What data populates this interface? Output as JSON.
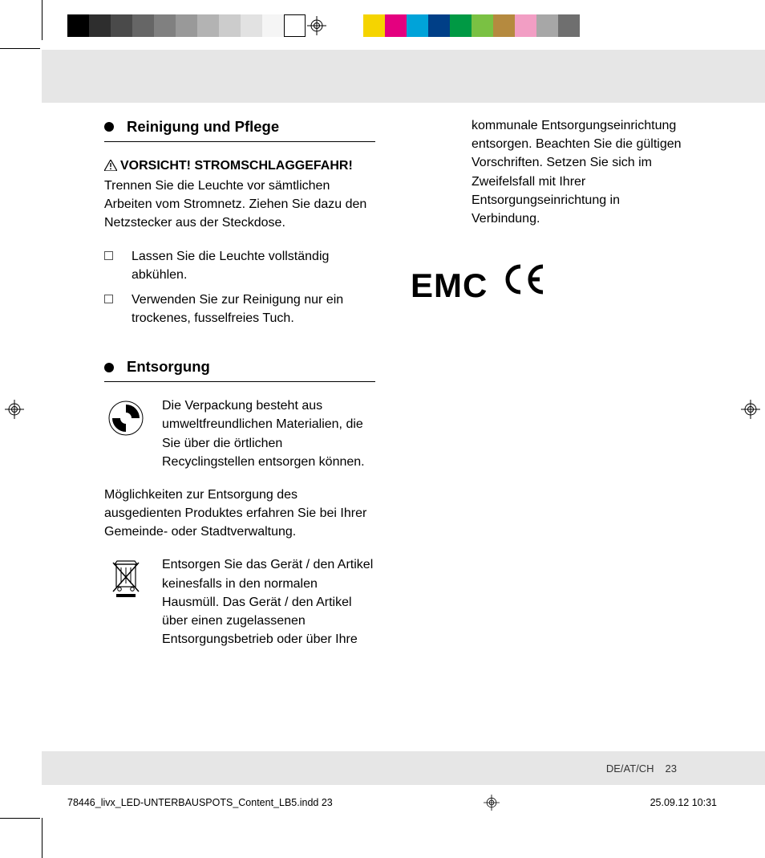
{
  "colorbar": {
    "left_group": [
      "#000000",
      "#2e2e2e",
      "#4a4a4a",
      "#666666",
      "#808080",
      "#999999",
      "#b3b3b3",
      "#cccccc",
      "#e2e2e2",
      "#f5f5f5",
      "#ffffff"
    ],
    "right_group": [
      "#f5d400",
      "#e4007f",
      "#00a3d9",
      "#003f87",
      "#009944",
      "#7ac143",
      "#b58a3f",
      "#f29ec4",
      "#a7a7a7",
      "#6f6f6f"
    ]
  },
  "section1": {
    "title": "Reinigung und Pflege",
    "warn_bold": "VORSICHT! STROMSCHLAGGEFAHR!",
    "warn_text": " Trennen Sie die Leuchte vor sämtlichen Arbeiten vom Stromnetz. Ziehen Sie dazu den Netzstecker aus der Steckdose.",
    "bullets": [
      "Lassen Sie die Leuchte vollständig abkühlen.",
      "Verwenden Sie zur Reinigung nur ein trockenes, fusselfreies Tuch."
    ]
  },
  "section2": {
    "title": "Entsorgung",
    "recycle_text": "Die Verpackung besteht aus umweltfreundlichen Materialien, die Sie über die örtlichen Recyclingstellen entsorgen können.",
    "mid_para": "Möglichkeiten zur Entsorgung des ausgedienten Produktes erfahren Sie bei Ihrer Gemeinde- oder Stadtverwaltung.",
    "weee_text": "Entsorgen Sie das Gerät / den Artikel keinesfalls in den normalen Hausmüll. Das Gerät / den Artikel über einen zugelassenen Entsorgungsbetrieb oder über Ihre"
  },
  "col_right": {
    "continuation": "kommunale Entsorgungseinrichtung entsorgen. Beachten Sie die gültigen Vorschriften. Setzen Sie sich im Zweifelsfall mit Ihrer Entsorgungseinrichtung in Verbindung.",
    "emc": "EMC"
  },
  "footer": {
    "locale": "DE/AT/CH",
    "page_no": "23"
  },
  "slug": {
    "file": "78446_livx_LED-UNTERBAUSPOTS_Content_LB5.indd   23",
    "date": "25.09.12   10:31"
  }
}
